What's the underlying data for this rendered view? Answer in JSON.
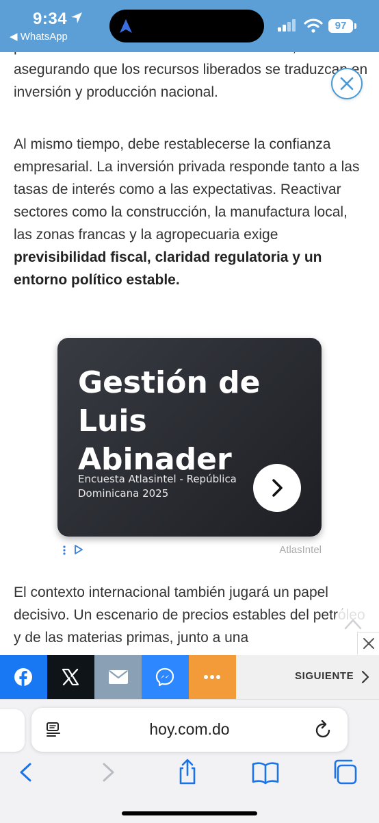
{
  "status_bar": {
    "time": "9:34",
    "back_app": "◀ WhatsApp",
    "battery": "97"
  },
  "article": {
    "p1": "política monetaria a los bancos comerciales, asegurando que los recursos liberados se traduzcan en inversión y producción nacional.",
    "p2_plain": "Al mismo tiempo, debe restablecerse la confianza empresarial. La inversión privada responde tanto a las tasas de interés como a las expectativas. Reactivar sectores como la construcción, la manufactura local, las zonas francas y la agropecuaria exige ",
    "p2_bold": "previsibilidad fiscal, claridad regulatoria y un entorno político estable.",
    "p3": "El contexto internacional también jugará un papel decisivo. Un escenario de precios estables del petróleo y de las materias primas, junto a una"
  },
  "ad": {
    "title": "Gestión de Luis Abinader",
    "subtitle": "Encuesta Atlasintel - República Dominicana 2025",
    "brand": "AtlasIntel"
  },
  "share_bar": {
    "next_label": "SIGUIENTE"
  },
  "browser": {
    "url": "hoy.com.do"
  },
  "colors": {
    "status_bar": "#5b9fd6",
    "facebook": "#1877f2",
    "x": "#0f1419",
    "email": "#8aa0b4",
    "messenger": "#2d88ff",
    "more": "#f29b38",
    "ios_blue": "#1a73e8"
  },
  "icons": [
    "location-arrow-icon",
    "signal-icon",
    "wifi-icon",
    "close-icon",
    "chevron-right-icon",
    "adchoices-icon",
    "chevron-up-icon",
    "facebook-icon",
    "x-icon",
    "email-icon",
    "messenger-icon",
    "more-icon",
    "reader-icon",
    "reload-icon",
    "back-icon",
    "forward-icon",
    "share-icon",
    "bookmarks-icon",
    "tabs-icon"
  ]
}
